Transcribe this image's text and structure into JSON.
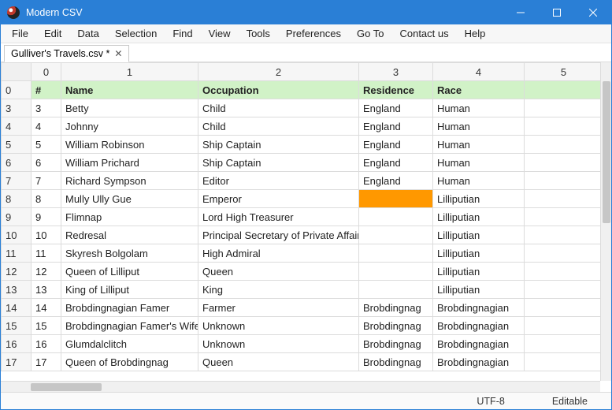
{
  "app": {
    "title": "Modern CSV"
  },
  "menu": {
    "items": [
      "File",
      "Edit",
      "Data",
      "Selection",
      "Find",
      "View",
      "Tools",
      "Preferences",
      "Go To",
      "Contact us",
      "Help"
    ]
  },
  "tab": {
    "label": "Gulliver's Travels.csv *"
  },
  "columns": [
    "0",
    "1",
    "2",
    "3",
    "4",
    "5",
    ""
  ],
  "rows": [
    {
      "idx": "0",
      "cells": [
        "#",
        "Name",
        "Occupation",
        "Residence",
        "Race",
        "",
        ""
      ],
      "header": true
    },
    {
      "idx": "3",
      "cells": [
        "3",
        "Betty",
        "Child",
        "England",
        "Human",
        "",
        ""
      ]
    },
    {
      "idx": "4",
      "cells": [
        "4",
        "Johnny",
        "Child",
        "England",
        "Human",
        "",
        ""
      ]
    },
    {
      "idx": "5",
      "cells": [
        "5",
        "William Robinson",
        "Ship Captain",
        "England",
        "Human",
        "",
        ""
      ]
    },
    {
      "idx": "6",
      "cells": [
        "6",
        "William Prichard",
        "Ship Captain",
        "England",
        "Human",
        "",
        ""
      ]
    },
    {
      "idx": "7",
      "cells": [
        "7",
        "Richard Sympson",
        "Editor",
        "England",
        "Human",
        "",
        ""
      ]
    },
    {
      "idx": "8",
      "cells": [
        "8",
        "Mully Ully Gue",
        "Emperor",
        "",
        "Lilliputian",
        "",
        ""
      ],
      "highlightCol": 3
    },
    {
      "idx": "9",
      "cells": [
        "9",
        "Flimnap",
        "Lord High Treasurer",
        "",
        "Lilliputian",
        "",
        ""
      ]
    },
    {
      "idx": "10",
      "cells": [
        "10",
        "Redresal",
        "Principal Secretary of Private Affairs",
        "",
        "Lilliputian",
        "",
        ""
      ]
    },
    {
      "idx": "11",
      "cells": [
        "11",
        "Skyresh Bolgolam",
        "High Admiral",
        "",
        "Lilliputian",
        "",
        ""
      ]
    },
    {
      "idx": "12",
      "cells": [
        "12",
        "Queen of Lilliput",
        "Queen",
        "",
        "Lilliputian",
        "",
        ""
      ]
    },
    {
      "idx": "13",
      "cells": [
        "13",
        "King of Lilliput",
        "King",
        "",
        "Lilliputian",
        "",
        ""
      ]
    },
    {
      "idx": "14",
      "cells": [
        "14",
        "Brobdingnagian Famer",
        "Farmer",
        "Brobdingnag",
        "Brobdingnagian",
        "",
        ""
      ]
    },
    {
      "idx": "15",
      "cells": [
        "15",
        "Brobdingnagian Famer's Wife",
        "Unknown",
        "Brobdingnag",
        "Brobdingnagian",
        "",
        ""
      ]
    },
    {
      "idx": "16",
      "cells": [
        "16",
        "Glumdalclitch",
        "Unknown",
        "Brobdingnag",
        "Brobdingnagian",
        "",
        ""
      ]
    },
    {
      "idx": "17",
      "cells": [
        "17",
        "Queen of Brobdingnag",
        "Queen",
        "Brobdingnag",
        "Brobdingnagian",
        "",
        ""
      ]
    }
  ],
  "status": {
    "encoding": "UTF-8",
    "mode": "Editable"
  }
}
